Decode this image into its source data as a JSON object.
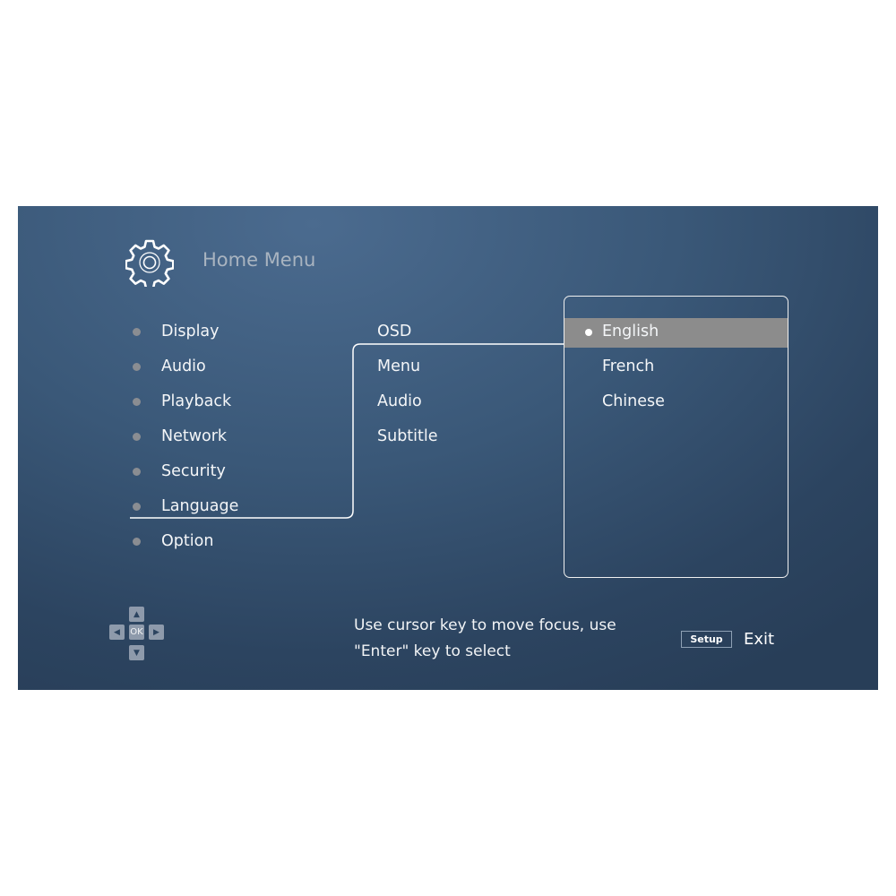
{
  "header": {
    "title": "Home Menu",
    "icon": "gear-icon"
  },
  "main_menu": {
    "items": [
      {
        "label": "Display"
      },
      {
        "label": "Audio"
      },
      {
        "label": "Playback"
      },
      {
        "label": "Network"
      },
      {
        "label": "Security"
      },
      {
        "label": "Language",
        "selected": true
      },
      {
        "label": "Option"
      }
    ]
  },
  "sub_menu": {
    "items": [
      {
        "label": "OSD",
        "selected": true
      },
      {
        "label": "Menu"
      },
      {
        "label": "Audio"
      },
      {
        "label": "Subtitle"
      }
    ]
  },
  "options": {
    "items": [
      {
        "label": "English",
        "selected": true
      },
      {
        "label": "French"
      },
      {
        "label": "Chinese"
      }
    ]
  },
  "footer": {
    "dpad": {
      "up": "▲",
      "down": "▼",
      "left": "◀",
      "right": "▶",
      "ok": "OK"
    },
    "hint_line1": "Use cursor key to move focus, use",
    "hint_line2": "\"Enter\" key to select",
    "setup_key": "Setup",
    "exit_label": "Exit"
  },
  "colors": {
    "background": "#3a5878",
    "highlight": "#8c8c8c",
    "text": "#f4f6f8",
    "title": "#a9b4c0"
  }
}
